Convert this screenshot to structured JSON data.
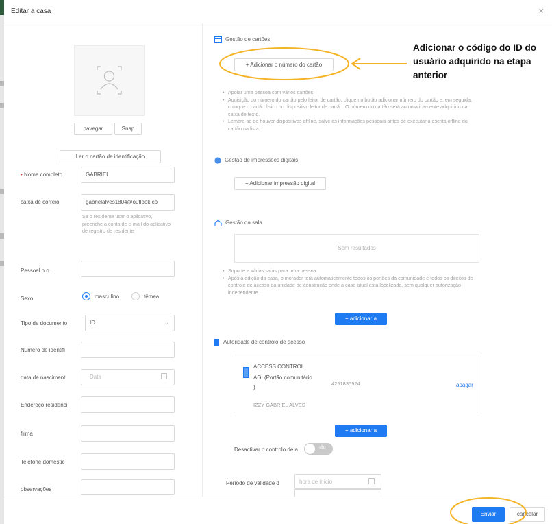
{
  "dialog": {
    "title": "Editar a casa",
    "close_glyph": "×"
  },
  "left": {
    "browse_button": "navegar",
    "snap_button": "Snap",
    "read_id_button": "Ler o cartão de identificação",
    "fields": {
      "full_name_label": "Nome completo",
      "full_name_value": "GABRIEL",
      "email_label": "caixa de correio",
      "email_value": "gabrielalves1804@outlook.co",
      "email_hint": "Se o residente usar o aplicativo, preenche a conta de e-mail do aplicativo de registro de residente",
      "personal_no_label": "Pessoal n.o.",
      "sex_label": "Sexo",
      "sex_male": "masculino",
      "sex_female": "fêmea",
      "doc_type_label": "Tipo de documento",
      "doc_type_value": "ID",
      "id_number_label": "Número de identifi",
      "birth_date_label": "data de nasciment",
      "birth_date_placeholder": "Data",
      "address_label": "Endereço residenci",
      "company_label": "firma",
      "home_phone_label": "Telefone doméstic",
      "notes_label": "observações"
    }
  },
  "right": {
    "card_section": {
      "title": "Gestão de cartões",
      "add_card_button": "+ Adicionar o número do cartão",
      "hints": [
        "Apoiar uma pessoa com vários cartões.",
        "Aquisição do número do cartão pelo leitor de cartão: clique no botão adicionar número do cartão e, em seguida, coloque o cartão físico no dispositivo leitor de cartão. O número do cartão será automaticamente adquirido na caixa de texto.",
        "Lembre-se de houver dispositivos offline, salve as informações pessoais antes de executar a escrita offline do cartão na lista."
      ]
    },
    "fingerprint_section": {
      "title": "Gestão de impressões digitais",
      "add_button": "+ Adicionar impressão digital"
    },
    "room_section": {
      "title": "Gestão da sala",
      "empty_text": "Sem resultados",
      "hints": [
        "Suporte a várias salas para uma pessoa.",
        "Após a edição da casa, o morador terá automaticamente todos os portões da comunidade e todos os direitos de controle de acesso da unidade de construção onde a casa atual está localizada, sem qualquer autorização independente."
      ],
      "add_button": "+ adicionar a"
    },
    "access_section": {
      "title": "Autoridade de controlo de acesso",
      "item_title": "ACCESS CONTROL",
      "item_name": "AGL(Portão comunitário",
      "item_paren": ")",
      "item_serial": "4251835924",
      "item_owner": "IZZY GABRIEL ALVES",
      "delete_link": "apagar",
      "add_button": "+ adicionar a",
      "disable_label": "Desactivar o controlo de a",
      "toggle_text": "não",
      "validity_label": "Período de validade d",
      "start_placeholder": "hora de início"
    }
  },
  "footer": {
    "submit": "Enviar",
    "cancel": "cancelar"
  },
  "annotation": {
    "text": "Adicionar o código do ID do usuário adquirido na etapa anterior"
  },
  "colors": {
    "primary": "#1e7bf2",
    "highlight": "#f5b428",
    "required": "#e03b3b"
  }
}
